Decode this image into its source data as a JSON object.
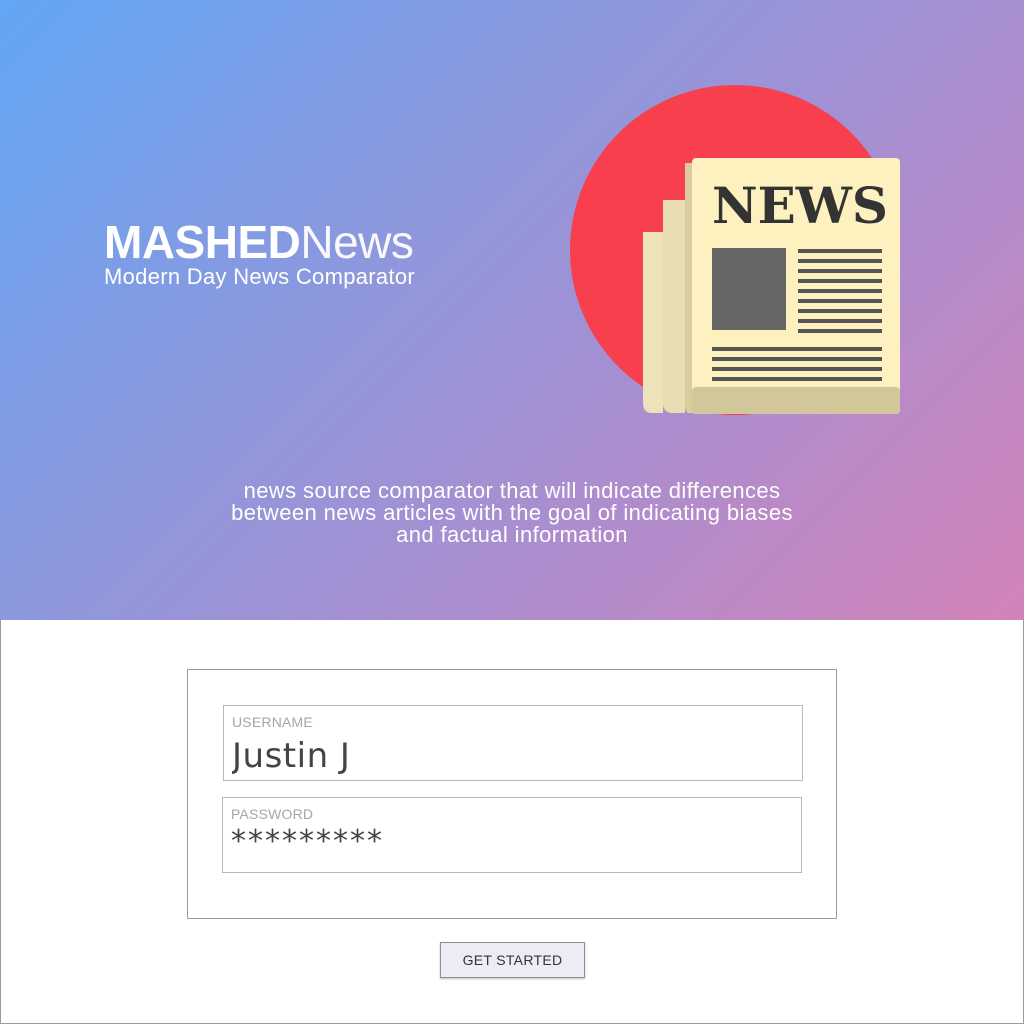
{
  "brand": {
    "logo_strong": "MASHED",
    "logo_light": "News",
    "tagline": "Modern Day News Comparator"
  },
  "illustration": {
    "icon": "newspaper-icon",
    "headline": "NEWS",
    "circle_color": "#f73f4d",
    "paper_color": "#fdf1c0"
  },
  "description": {
    "line1": "news source comparator that will indicate differences",
    "line2": "between news articles with the goal of indicating biases",
    "line3": "and factual information"
  },
  "login": {
    "username_label": "USERNAME",
    "username_value": "Justin J",
    "password_label": "PASSWORD",
    "password_value": "*********",
    "submit_label": "GET STARTED"
  },
  "colors": {
    "gradient_start": "#62a6f4",
    "gradient_end": "#d283b8"
  }
}
